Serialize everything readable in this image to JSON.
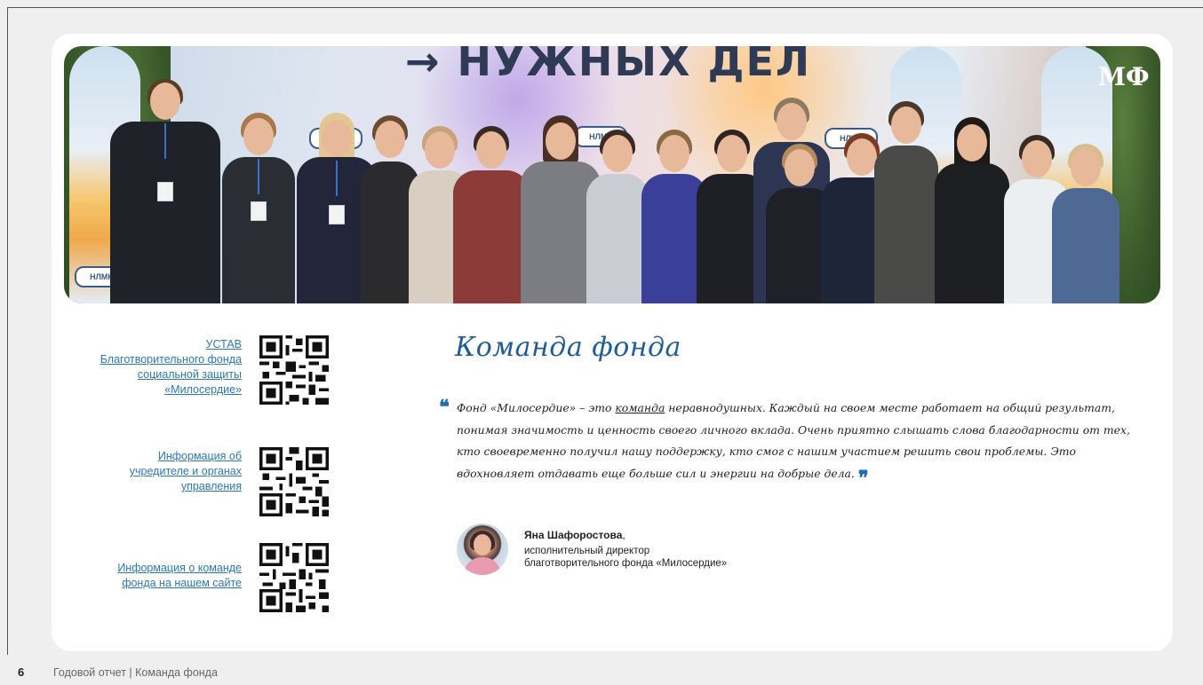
{
  "photo": {
    "banner_text": "→ НУЖНЫХ ДЕЛ",
    "logo": "МФ"
  },
  "qr_links": [
    {
      "text": "УСТАВ Благотворительного фонда социальной защиты «Милосердие»",
      "icon": "qr-code-icon"
    },
    {
      "text": "Информация об учредителе и органах управления",
      "icon": "qr-code-icon"
    },
    {
      "text": "Информация о команде фонда на нашем сайте",
      "icon": "qr-code-icon"
    }
  ],
  "section": {
    "heading": "Команда фонда",
    "quote_open": "❝",
    "quote_part1": "Фонд «Милосердие» – это ",
    "quote_link": "команда",
    "quote_part2": " неравнодушных. Каждый на своем месте работает на общий результат, понимая значимость и ценность своего личного вклада. Очень приятно слышать слова благодарности от тех, кто своевременно получил нашу поддержку, кто смог с нашим участием решить свои проблемы. Это вдохновляет отдавать еще больше сил и энергии на добрые дела.",
    "quote_close": "❞"
  },
  "author": {
    "name": "Яна Шафоростова",
    "role_line1": "исполнительный директор",
    "role_line2": "благотворительного фонда «Милосердие»"
  },
  "footer": {
    "page_number": "6",
    "text": "Годовой отчет | Команда фонда"
  },
  "colors": {
    "accent": "#1e5d9a",
    "link": "#2a78b8",
    "background": "#efefef"
  }
}
